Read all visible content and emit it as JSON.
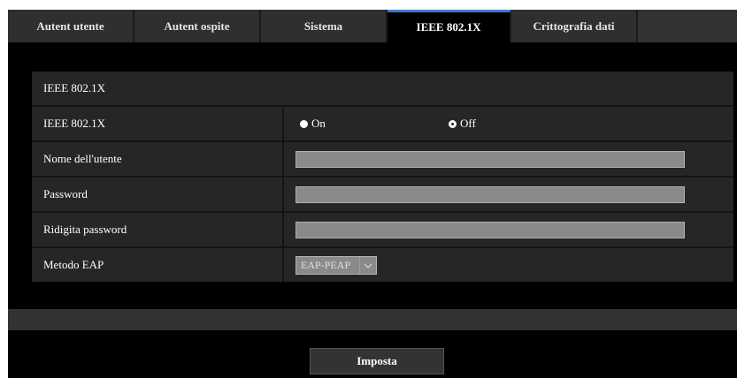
{
  "tabs": [
    {
      "label": "Autent utente",
      "active": false
    },
    {
      "label": "Autent ospite",
      "active": false
    },
    {
      "label": "Sistema",
      "active": false
    },
    {
      "label": "IEEE 802.1X",
      "active": true
    },
    {
      "label": "Crittografia dati",
      "active": false
    }
  ],
  "section": {
    "title": "IEEE 802.1X"
  },
  "form": {
    "ieee_label": "IEEE 802.1X",
    "on_label": "On",
    "off_label": "Off",
    "selected": "Off",
    "username_label": "Nome dell'utente",
    "username_value": "",
    "password_label": "Password",
    "password_value": "",
    "repassword_label": "Ridigita password",
    "repassword_value": "",
    "eap_label": "Metodo EAP",
    "eap_value": "EAP-PEAP"
  },
  "submit_label": "Imposta",
  "colors": {
    "accent": "#3a7bd5",
    "background": "#000000",
    "row": "#262626",
    "field": "#8a8a8a"
  }
}
